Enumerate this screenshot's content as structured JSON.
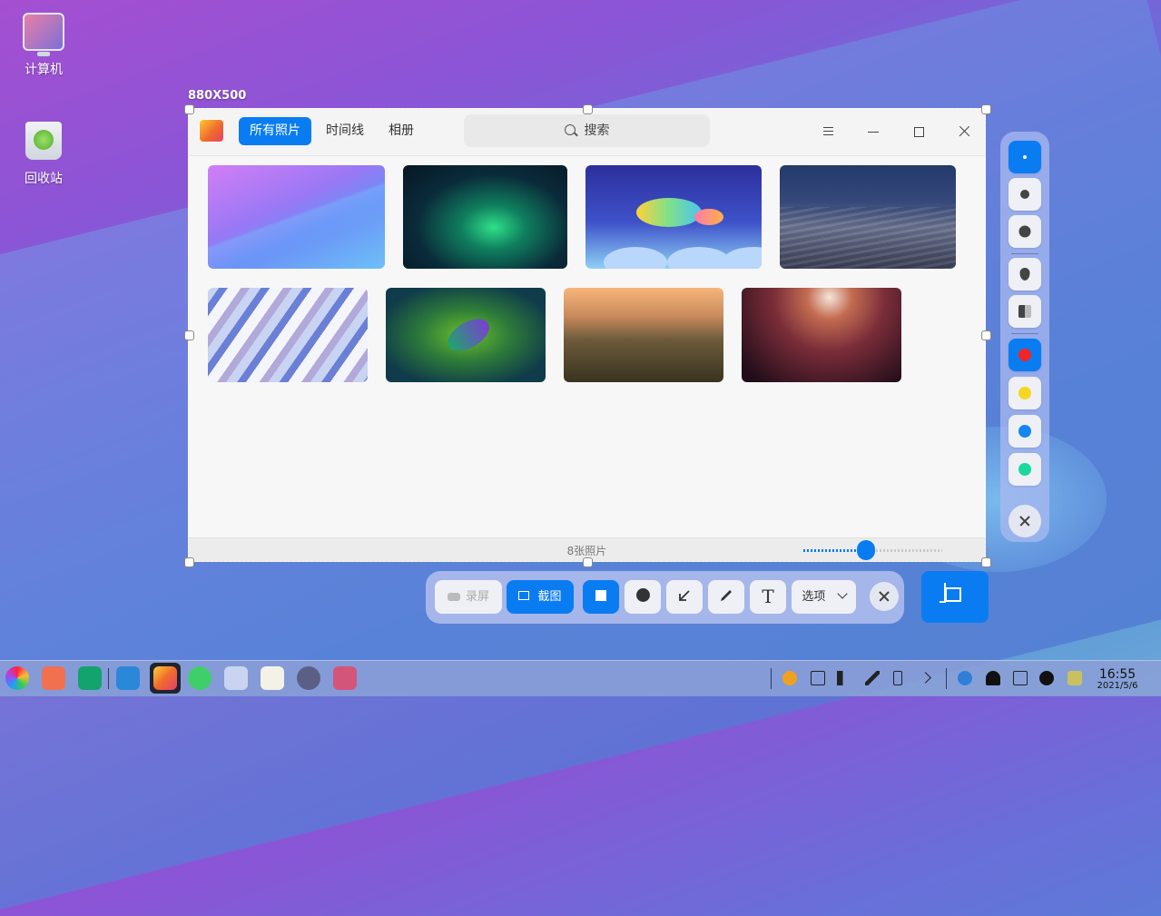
{
  "desktop": {
    "icons": [
      {
        "label": "计算机"
      },
      {
        "label": "回收站"
      }
    ]
  },
  "selection": {
    "size_label": "880X500"
  },
  "app": {
    "tabs": [
      {
        "label": "所有照片",
        "active": true
      },
      {
        "label": "时间线",
        "active": false
      },
      {
        "label": "相册",
        "active": false
      }
    ],
    "search_placeholder": "搜索",
    "photo_count": "8张照片",
    "zoom_level": 0.45,
    "photos": [
      "purple-gradient",
      "aurora",
      "rainbow-fish",
      "desert-dunes",
      "light-streaks",
      "hummingbird",
      "mountains",
      "canyon"
    ]
  },
  "side_toolbar": {
    "sizes": [
      "small",
      "medium",
      "large"
    ],
    "effects": [
      "blur",
      "mosaic"
    ],
    "colors": [
      "#f02525",
      "#f5d623",
      "#1686f0",
      "#1ad8a0"
    ],
    "accent": "#0a7cf2"
  },
  "bottom_toolbar": {
    "record_label": "录屏",
    "screenshot_label": "截图",
    "options_label": "选项"
  },
  "taskbar": {
    "time": "16:55",
    "date": "2021/5/6"
  }
}
